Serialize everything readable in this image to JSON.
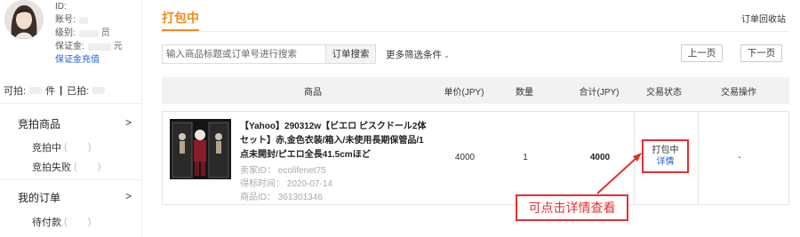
{
  "user": {
    "id_label": "ID:",
    "account_label": "账号:",
    "level_label": "级别:",
    "level_suffix": "员",
    "deposit_label": "保证金:",
    "deposit_suffix": "元",
    "recharge_link": "保证金充值"
  },
  "bid_summary": {
    "can_bid_label": "可拍:",
    "can_bid_unit": "件",
    "separator": "|",
    "bid_label": "已拍:"
  },
  "sidebar": {
    "section1_title": "竞拍商品",
    "section1_arrow": ">",
    "items1": [
      {
        "label": "竞拍中",
        "paren": "( )"
      },
      {
        "label": "竞拍失败",
        "paren": "( )"
      }
    ],
    "section2_title": "我的订单",
    "section2_arrow": ">",
    "items2": [
      {
        "label": "待付款",
        "paren": "( )"
      }
    ]
  },
  "main": {
    "active_tab": "打包中",
    "recycle_link": "订单回收站",
    "search_placeholder": "输入商品标题或订单号进行搜索",
    "search_button": "订单搜索",
    "more_filters": "更多筛选条件",
    "more_filters_icon": "chevron-down-icon",
    "prev_page": "上一页",
    "next_page": "下一页"
  },
  "table": {
    "headers": {
      "product": "商品",
      "unit_price": "单价(JPY)",
      "quantity": "数量",
      "total": "合计(JPY)",
      "status": "交易状态",
      "action": "交易操作"
    },
    "rows": [
      {
        "title": "【Yahoo】290312w【ビエロ ピスクドール2体セット】赤,金色衣装/箱入/未使用長期保管品/1点未開封/ピエロ全長41.5cmほど",
        "seller": "卖家ID： ecolifenet75",
        "won_time": "得标时间： 2020-07-14",
        "product_id": "商品ID： 361301346",
        "unit_price": "4000",
        "quantity": "1",
        "total": "4000",
        "status": "打包中",
        "detail_link": "详情",
        "action": "-"
      }
    ]
  },
  "callout": {
    "text": "可点击详情查看",
    "color": "#e52f2f"
  },
  "colors": {
    "accent": "#f08a1c",
    "link": "#1a5fd0",
    "highlight": "#e52f2f"
  }
}
